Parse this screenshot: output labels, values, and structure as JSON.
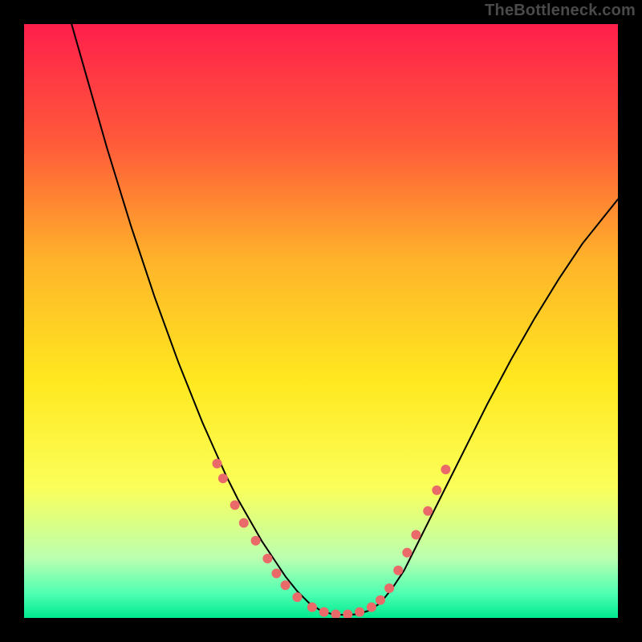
{
  "watermark": "TheBottleneck.com",
  "chart_data": {
    "type": "line",
    "title": "",
    "xlabel": "",
    "ylabel": "",
    "xlim": [
      0,
      100
    ],
    "ylim": [
      0,
      100
    ],
    "grid": false,
    "legend": null,
    "background_gradient_stops": [
      {
        "offset": 0.0,
        "color": "#ff1f4b"
      },
      {
        "offset": 0.2,
        "color": "#ff5a3a"
      },
      {
        "offset": 0.4,
        "color": "#ffb42a"
      },
      {
        "offset": 0.6,
        "color": "#ffe81f"
      },
      {
        "offset": 0.78,
        "color": "#fbff5a"
      },
      {
        "offset": 0.9,
        "color": "#baffb0"
      },
      {
        "offset": 0.96,
        "color": "#4dffb2"
      },
      {
        "offset": 1.0,
        "color": "#00e98e"
      }
    ],
    "series": [
      {
        "name": "curve",
        "color": "#000000",
        "stroke_width": 2,
        "x": [
          8,
          10,
          12,
          14,
          16,
          18,
          20,
          22,
          24,
          26,
          28,
          30,
          32,
          34,
          36,
          38,
          40,
          42,
          44,
          46,
          48,
          50,
          52,
          54,
          56,
          58,
          60,
          62,
          64,
          66,
          68,
          70,
          74,
          78,
          82,
          86,
          90,
          94,
          98,
          100
        ],
        "y": [
          100,
          93,
          86,
          79,
          72.5,
          66,
          60,
          54,
          48.5,
          43,
          38,
          33,
          28.5,
          24,
          20,
          16.5,
          13,
          10,
          7,
          4.5,
          2.5,
          1.2,
          0.6,
          0.5,
          0.6,
          1.2,
          2.5,
          5,
          8,
          12,
          16,
          20,
          28,
          36,
          43.5,
          50.5,
          57,
          63,
          68,
          70.5
        ]
      }
    ],
    "marker_series": {
      "name": "dots",
      "color": "#ea6a6a",
      "radius_px": 6,
      "points": [
        {
          "x": 32.5,
          "y": 26
        },
        {
          "x": 33.5,
          "y": 23.5
        },
        {
          "x": 35.5,
          "y": 19
        },
        {
          "x": 37,
          "y": 16
        },
        {
          "x": 39,
          "y": 13
        },
        {
          "x": 41,
          "y": 10
        },
        {
          "x": 42.5,
          "y": 7.5
        },
        {
          "x": 44,
          "y": 5.5
        },
        {
          "x": 46,
          "y": 3.5
        },
        {
          "x": 48.5,
          "y": 1.8
        },
        {
          "x": 50.5,
          "y": 1.0
        },
        {
          "x": 52.5,
          "y": 0.6
        },
        {
          "x": 54.5,
          "y": 0.6
        },
        {
          "x": 56.5,
          "y": 1.0
        },
        {
          "x": 58.5,
          "y": 1.8
        },
        {
          "x": 60,
          "y": 3
        },
        {
          "x": 61.5,
          "y": 5
        },
        {
          "x": 63,
          "y": 8
        },
        {
          "x": 64.5,
          "y": 11
        },
        {
          "x": 66,
          "y": 14
        },
        {
          "x": 68,
          "y": 18
        },
        {
          "x": 69.5,
          "y": 21.5
        },
        {
          "x": 71,
          "y": 25
        }
      ]
    }
  }
}
